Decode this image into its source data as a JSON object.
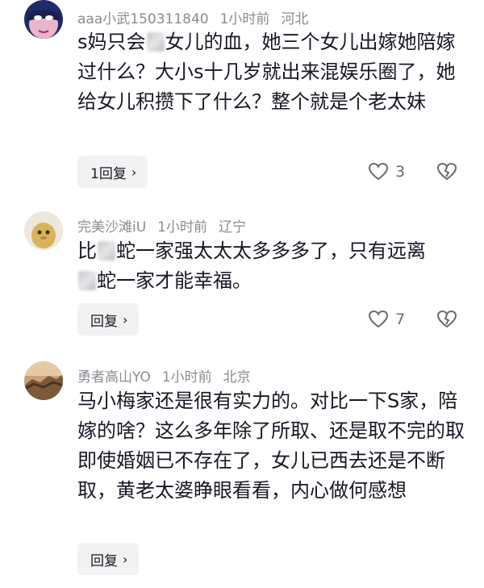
{
  "comments": [
    {
      "username": "aaa小武150311840",
      "time": "1小时前",
      "location": "河北",
      "text_a": "s妈只会",
      "text_b": "女儿的血，她三个女儿出嫁她陪嫁过什么？大小s十几岁就出来混娱乐圈了，她给女儿积攒下了什么？整个就是个老太妹",
      "reply_label": "1回复",
      "likes": "3",
      "avatar_icon": "masked-avatar-icon"
    },
    {
      "username": "完美沙滩iU",
      "time": "1小时前",
      "location": "辽宁",
      "text_a": "比",
      "text_b": "蛇一家强太太太多多多了，只有远离",
      "text_c": "蛇一家才能幸福。",
      "reply_label": "回复",
      "likes": "7",
      "avatar_icon": "cartoon-avatar-icon"
    },
    {
      "username": "勇者高山YO",
      "time": "1小时前",
      "location": "北京",
      "text": "马小梅家还是很有实力的。对比一下S家，陪嫁的啥？这么多年除了所取、还是取不完的取即使婚姻已不存在了，女儿已西去还是不断取，黄老太婆睁眼看看，内心做何感想",
      "reply_label": "回复",
      "avatar_icon": "great-wall-avatar-icon"
    }
  ],
  "icons": {
    "like": "heart-icon",
    "dislike": "broken-heart-icon",
    "chevron": "chevron-right-icon"
  },
  "colors": {
    "text": "#161823",
    "meta": "#8a8b91",
    "reply_bg": "#f2f2f3"
  }
}
